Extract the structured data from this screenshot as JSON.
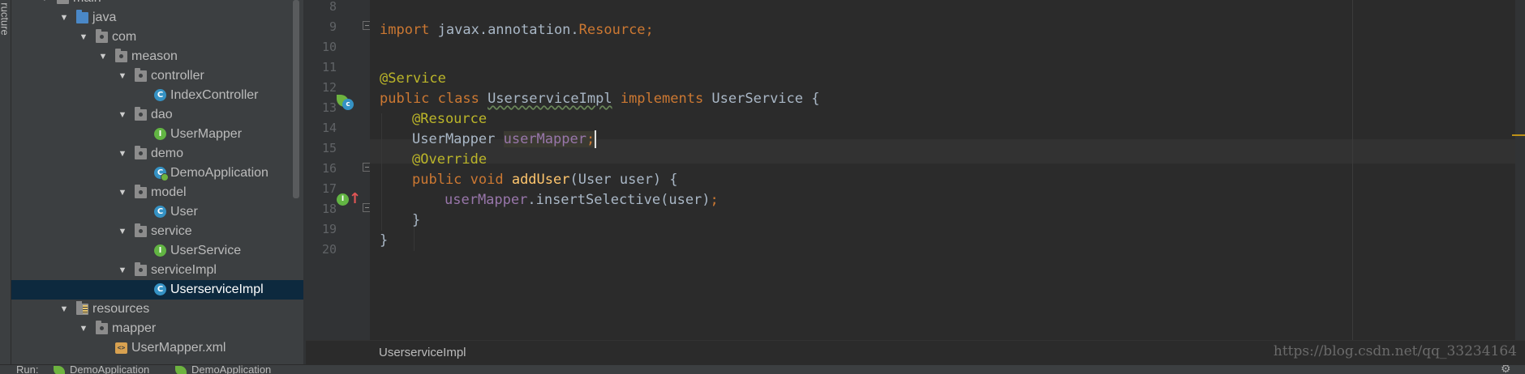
{
  "left_strip_label": "ructure",
  "project_tree": [
    {
      "label": "main",
      "depth": 2,
      "type": "folder",
      "expanded": true
    },
    {
      "label": "java",
      "depth": 3,
      "type": "folder-blue",
      "expanded": true
    },
    {
      "label": "com",
      "depth": 4,
      "type": "folder",
      "expanded": true
    },
    {
      "label": "meason",
      "depth": 5,
      "type": "folder",
      "expanded": true
    },
    {
      "label": "controller",
      "depth": 6,
      "type": "folder",
      "expanded": true
    },
    {
      "label": "IndexController",
      "depth": 7,
      "type": "class"
    },
    {
      "label": "dao",
      "depth": 6,
      "type": "folder",
      "expanded": true
    },
    {
      "label": "UserMapper",
      "depth": 7,
      "type": "interface"
    },
    {
      "label": "demo",
      "depth": 6,
      "type": "folder",
      "expanded": true
    },
    {
      "label": "DemoApplication",
      "depth": 7,
      "type": "spring-class"
    },
    {
      "label": "model",
      "depth": 6,
      "type": "folder",
      "expanded": true
    },
    {
      "label": "User",
      "depth": 7,
      "type": "class"
    },
    {
      "label": "service",
      "depth": 6,
      "type": "folder",
      "expanded": true
    },
    {
      "label": "UserService",
      "depth": 7,
      "type": "interface"
    },
    {
      "label": "serviceImpl",
      "depth": 6,
      "type": "folder",
      "expanded": true
    },
    {
      "label": "UserserviceImpl",
      "depth": 7,
      "type": "class",
      "selected": true
    },
    {
      "label": "resources",
      "depth": 3,
      "type": "folder-res",
      "expanded": true
    },
    {
      "label": "mapper",
      "depth": 4,
      "type": "folder",
      "expanded": true
    },
    {
      "label": "UserMapper.xml",
      "depth": 5,
      "type": "xml"
    }
  ],
  "editor": {
    "line_numbers": [
      "8",
      "9",
      "10",
      "11",
      "12",
      "13",
      "14",
      "15",
      "16",
      "17",
      "18",
      "19",
      "20"
    ],
    "code": {
      "l9_kw": "import",
      "l9_pkg": " javax.annotation.",
      "l9_cls": "Resource",
      "l9_semi": ";",
      "l11_ann": "@Service",
      "l12_kw1": "public class ",
      "l12_cls": "UserserviceImpl",
      "l12_kw2": " implements ",
      "l12_iface": "UserService {",
      "l13_ann": "@Resource",
      "l14_type": "UserMapper ",
      "l14_field": "userMapper",
      "l14_semi": ";",
      "l15_ann": "@Override",
      "l16_kw": "public void ",
      "l16_fn": "addUser",
      "l16_rest": "(User user) {",
      "l17_field": "userMapper",
      "l17_call": ".insertSelective(user)",
      "l17_semi": ";",
      "l18_brace": "}",
      "l19_brace": "}"
    },
    "breadcrumb": "UserserviceImpl"
  },
  "watermark": "https://blog.csdn.net/qq_33234164",
  "bottom_tabs": [
    "Run:",
    "DemoApplication",
    "DemoApplication"
  ],
  "colors": {
    "keyword": "#cc7832",
    "annotation": "#bbb529",
    "field": "#9876aa",
    "method": "#ffc66d",
    "plain": "#a9b7c6",
    "selection": "#0d293e"
  }
}
